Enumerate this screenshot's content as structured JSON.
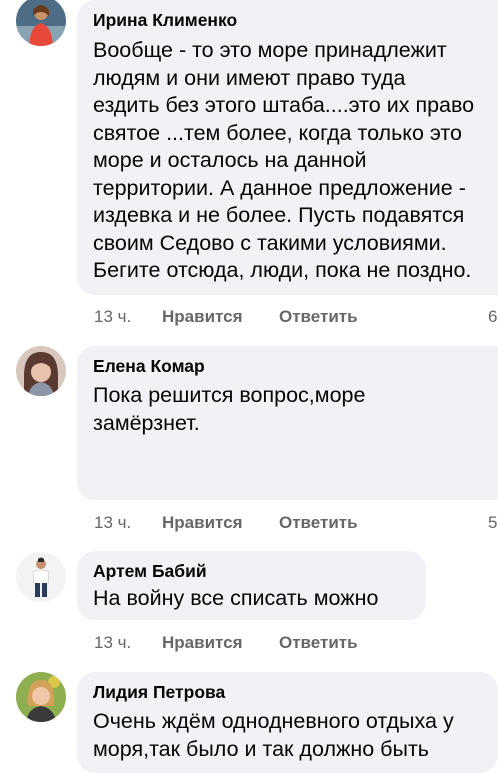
{
  "comments": [
    {
      "author": "Ирина Клименко",
      "lines": [
        "Вообще - то это море принадлежит",
        "людям и они имеют право туда",
        "ездить без этого штаба....это их право",
        "святое ...тем более, когда только это",
        "море и осталось на данной",
        "территории. А данное предложение -",
        "издевка и не более. Пусть подавятся",
        "своим Седово с такими условиями.",
        "Бегите отсюда, люди, пока не поздно."
      ],
      "time": "13 ч.",
      "like": "Нравится",
      "reply": "Ответить",
      "count": "6"
    },
    {
      "author": "Елена Комар",
      "lines": [
        "Пока решится вопрос,море",
        "замёрзнет."
      ],
      "time": "13 ч.",
      "like": "Нравится",
      "reply": "Ответить",
      "count": "5"
    },
    {
      "author": "Артем Бабий",
      "lines": [
        "На войну все списать можно"
      ],
      "time": "13 ч.",
      "like": "Нравится",
      "reply": "Ответить",
      "count": ""
    },
    {
      "author": "Лидия Петрова",
      "lines": [
        "Очень ждём однодневного отдыха у",
        "моря,так было и так должно быть"
      ],
      "time": "",
      "like": "",
      "reply": "",
      "count": ""
    }
  ]
}
